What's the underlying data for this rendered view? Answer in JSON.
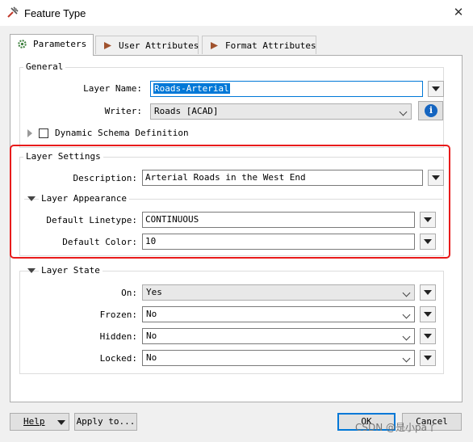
{
  "window": {
    "title": "Feature Type",
    "close_glyph": "✕"
  },
  "tabs": [
    {
      "label": "Parameters",
      "icon": "gear-icon"
    },
    {
      "label": "User Attributes",
      "icon": "diamond-arrow-icon"
    },
    {
      "label": "Format Attributes",
      "icon": "diamond-arrow-icon"
    }
  ],
  "general": {
    "group_label": "General",
    "layer_name_label": "Layer Name:",
    "layer_name_value": "Roads-Arterial",
    "writer_label": "Writer:",
    "writer_value": "Roads [ACAD]",
    "info_glyph": "i",
    "dynamic_schema_label": "Dynamic Schema Definition",
    "dynamic_schema_checked": false
  },
  "layer_settings": {
    "group_label": "Layer Settings",
    "description_label": "Description:",
    "description_value": "Arterial Roads in the West End",
    "appearance_label": "Layer Appearance",
    "linetype_label": "Default Linetype:",
    "linetype_value": "CONTINUOUS",
    "color_label": "Default Color:",
    "color_value": "10"
  },
  "layer_state": {
    "group_label": "Layer State",
    "rows": [
      {
        "label": "On:",
        "value": "Yes"
      },
      {
        "label": "Frozen:",
        "value": "No"
      },
      {
        "label": "Hidden:",
        "value": "No"
      },
      {
        "label": "Locked:",
        "value": "No"
      }
    ]
  },
  "footer": {
    "help_label": "Help",
    "apply_label": "Apply to...",
    "ok_label": "OK",
    "cancel_label": "Cancel"
  },
  "watermark": "CSDN @是小pa丫",
  "colors": {
    "accent": "#0078d7",
    "highlight": "#e81b1b"
  }
}
